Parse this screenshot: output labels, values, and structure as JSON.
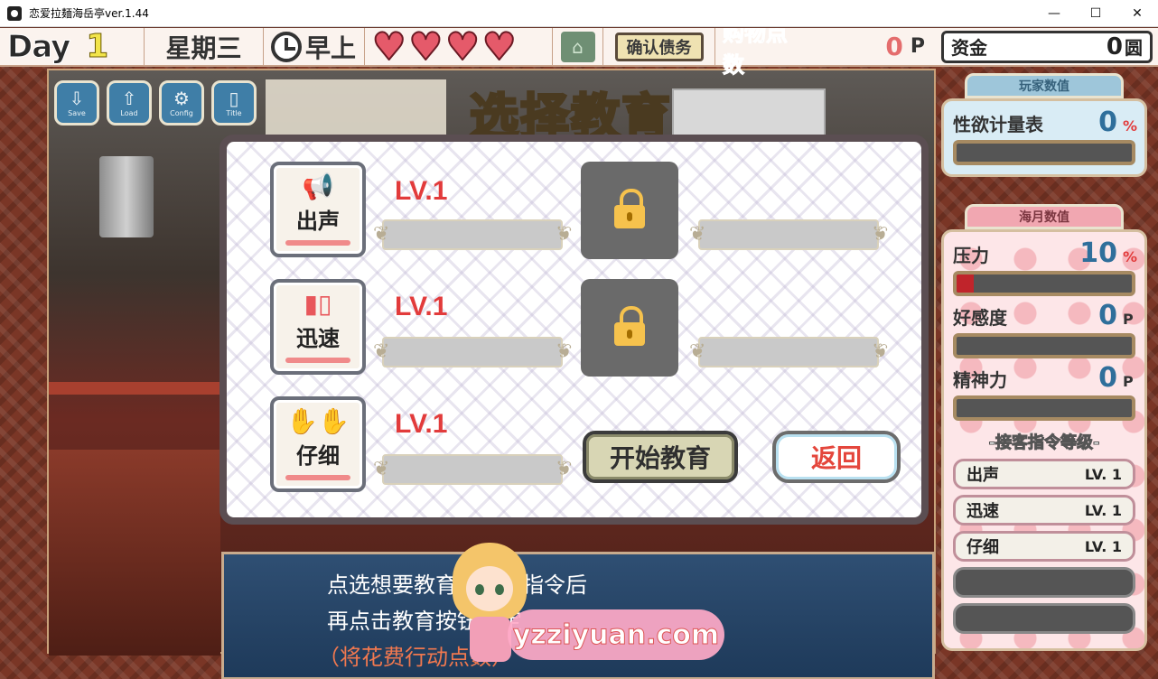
{
  "window": {
    "title": "恋爱拉麺海岳亭ver.1.44",
    "controls": {
      "minimize": "—",
      "maximize": "☐",
      "close": "✕"
    }
  },
  "hud": {
    "day_label": "Day",
    "day_number": "1",
    "weekday": "星期三",
    "time_of_day": "早上",
    "hearts": [
      "♥",
      "♥",
      "♥",
      "♥"
    ],
    "home_icon": "⌂",
    "confirm_debt": "确认债务",
    "shop_points_label": "购物点数",
    "shop_points_value": "0",
    "shop_points_unit": "P",
    "money_label": "资金",
    "money_value": "0",
    "money_unit": "圆"
  },
  "menu": [
    {
      "label": "Save",
      "icon": "⇩"
    },
    {
      "label": "Load",
      "icon": "⇧"
    },
    {
      "label": "Config",
      "icon": "⚙"
    },
    {
      "label": "Title",
      "icon": "▯"
    }
  ],
  "heading": "选择教育",
  "education": {
    "commands": [
      {
        "label": "出声",
        "icon": "📢",
        "level": "LV.1"
      },
      {
        "label": "迅速",
        "icon": "▮▯",
        "level": "LV.1"
      },
      {
        "label": "仔细",
        "icon": "✋✋",
        "level": "LV.1"
      }
    ],
    "start_button": "开始教育",
    "back_button": "返回"
  },
  "side": {
    "player_title": "玩家数值",
    "player_stat": {
      "label": "性欲计量表",
      "value": "0",
      "unit": "%",
      "fill": 0
    },
    "umi_title": "海月数值",
    "umi_stats": [
      {
        "label": "压力",
        "value": "10",
        "unit": "%",
        "fill": 0.1
      },
      {
        "label": "好感度",
        "value": "0",
        "unit": "P",
        "fill": 0
      },
      {
        "label": "精神力",
        "value": "0",
        "unit": "P",
        "fill": 0
      }
    ],
    "cmd_level_title": "-接客指令等级-",
    "cmd_levels": [
      {
        "label": "出声",
        "level": "LV. 1"
      },
      {
        "label": "迅速",
        "level": "LV. 1"
      },
      {
        "label": "仔细",
        "level": "LV. 1"
      }
    ]
  },
  "message": {
    "line1": "点选想要教育的接客指令后",
    "line2": "再点击教育按钮确定",
    "line3": "（将花费行动点数）"
  },
  "watermark": "yzziyuan.com",
  "colors": {
    "accent_red": "#e23b3b",
    "heading_yellow": "#fbf27a",
    "stat_blue": "#2f6f9b"
  }
}
